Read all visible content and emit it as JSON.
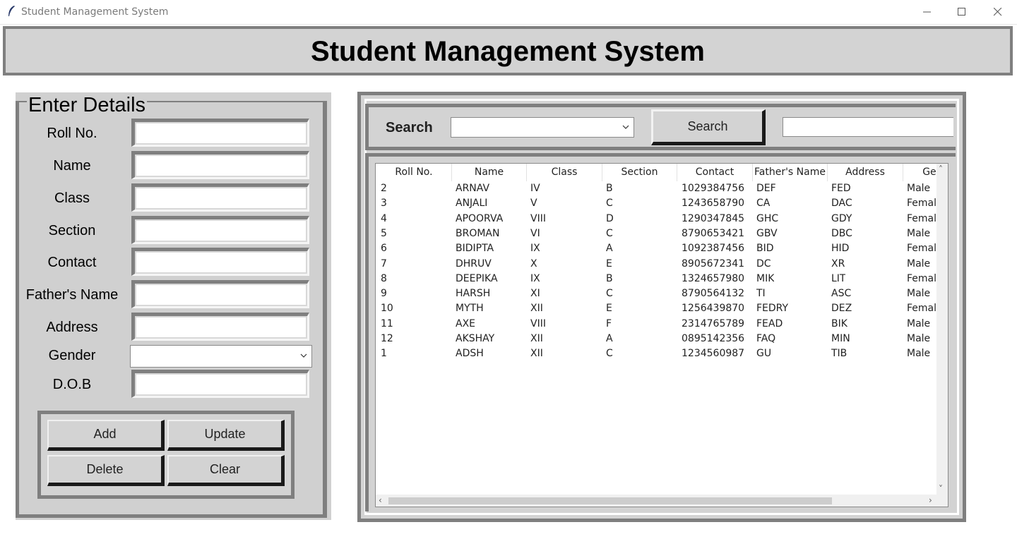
{
  "window": {
    "title": "Student Management System",
    "minimize_icon": "minimize-icon",
    "maximize_icon": "maximize-icon",
    "close_icon": "close-icon"
  },
  "header": {
    "title": "Student Management System"
  },
  "details": {
    "legend": "Enter Details",
    "fields": [
      {
        "label": "Roll No.",
        "value": ""
      },
      {
        "label": "Name",
        "value": ""
      },
      {
        "label": "Class",
        "value": ""
      },
      {
        "label": "Section",
        "value": ""
      },
      {
        "label": "Contact",
        "value": ""
      },
      {
        "label": "Father's Name",
        "value": ""
      },
      {
        "label": "Address",
        "value": ""
      },
      {
        "label": "Gender",
        "value": ""
      },
      {
        "label": "D.O.B",
        "value": ""
      }
    ],
    "buttons": {
      "add": "Add",
      "update": "Update",
      "delete": "Delete",
      "clear": "Clear"
    }
  },
  "search": {
    "label": "Search",
    "select_value": "",
    "button": "Search",
    "text_value": ""
  },
  "table": {
    "columns": [
      "Roll No.",
      "Name",
      "Class",
      "Section",
      "Contact",
      "Father's Name",
      "Address",
      "Gender"
    ],
    "rows": [
      [
        "2",
        "ARNAV",
        "IV",
        "B",
        "1029384756",
        "DEF",
        "FED",
        "Male"
      ],
      [
        "3",
        "ANJALI",
        "V",
        "C",
        "1243658790",
        "CA",
        "DAC",
        "Female"
      ],
      [
        "4",
        "APOORVA",
        "VIII",
        "D",
        "1290347845",
        "GHC",
        "GDY",
        "Female"
      ],
      [
        "5",
        "BROMAN",
        "VI",
        "C",
        "8790653421",
        "GBV",
        "DBC",
        "Male"
      ],
      [
        "6",
        "BIDIPTA",
        "IX",
        "A",
        "1092387456",
        "BID",
        "HID",
        "Female"
      ],
      [
        "7",
        "DHRUV",
        "X",
        "E",
        "8905672341",
        "DC",
        "XR",
        "Male"
      ],
      [
        "8",
        "DEEPIKA",
        "IX",
        "B",
        "1324657980",
        "MIK",
        "LIT",
        "Female"
      ],
      [
        "9",
        "HARSH",
        "XI",
        "C",
        "8790564132",
        "TI",
        "ASC",
        "Male"
      ],
      [
        "10",
        "MYTH",
        "XII",
        "E",
        "1256439870",
        "FEDRY",
        "DEZ",
        "Female"
      ],
      [
        "11",
        "AXE",
        "VIII",
        "F",
        "2314765789",
        "FEAD",
        "BIK",
        "Male"
      ],
      [
        "12",
        "AKSHAY",
        "XII",
        "A",
        "0895142356",
        "FAQ",
        "MIN",
        "Male"
      ],
      [
        "1",
        "ADSH",
        "XII",
        "C",
        "1234560987",
        "GU",
        "TIB",
        "Male"
      ]
    ]
  },
  "colors": {
    "panel_bg": "#d3d3d3",
    "border_dark": "#7f7f7f",
    "button_shadow": "#1a1a1a"
  }
}
